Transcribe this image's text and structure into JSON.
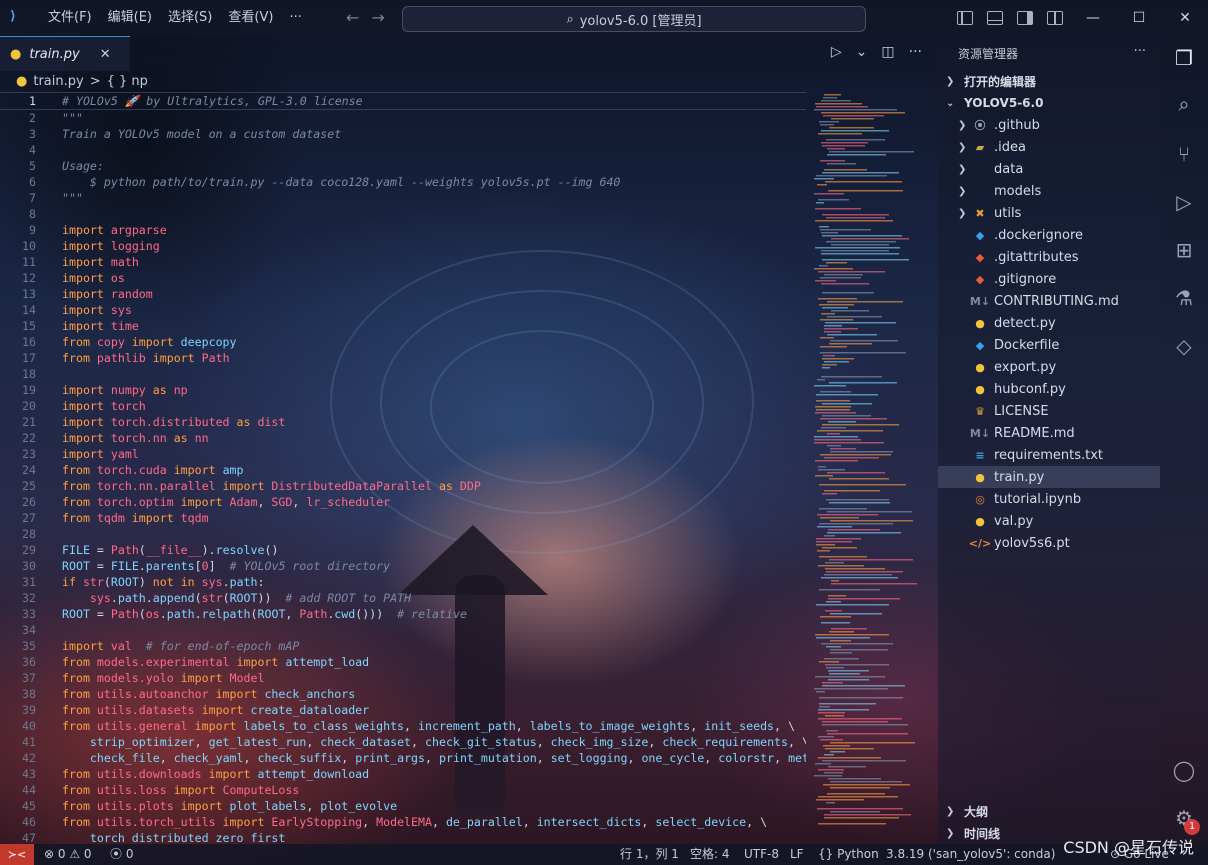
{
  "titlebar": {
    "menus": [
      "文件(F)",
      "编辑(E)",
      "选择(S)",
      "查看(V)"
    ],
    "more": "···",
    "search": "yolov5-6.0 [管理员]"
  },
  "tab": {
    "label": "train.py"
  },
  "breadcrumb": {
    "file": "train.py",
    "sep": ">",
    "symbol": "{ } np"
  },
  "explorer": {
    "header": "资源管理器",
    "more": "···",
    "open_editors": "打开的编辑器",
    "root": "YOLOV5-6.0",
    "items": [
      {
        "name": ".github",
        "type": "folder",
        "icon": "github-folder-icon",
        "glyph": "⦿",
        "color": "#9aa3b6"
      },
      {
        "name": ".idea",
        "type": "folder",
        "icon": "idea-folder-icon",
        "glyph": "▰",
        "color": "#c7a64a"
      },
      {
        "name": "data",
        "type": "folder",
        "icon": "folder-icon",
        "glyph": "",
        "color": "#c4cad8"
      },
      {
        "name": "models",
        "type": "folder",
        "icon": "folder-icon",
        "glyph": "",
        "color": "#c4cad8"
      },
      {
        "name": "utils",
        "type": "folder",
        "icon": "utils-folder-icon",
        "glyph": "✖",
        "color": "#e0a040"
      },
      {
        "name": ".dockerignore",
        "type": "file",
        "icon": "docker-icon",
        "glyph": "◆",
        "color": "#3aa0e6"
      },
      {
        "name": ".gitattributes",
        "type": "file",
        "icon": "git-icon",
        "glyph": "◆",
        "color": "#e55d3b"
      },
      {
        "name": ".gitignore",
        "type": "file",
        "icon": "git-icon",
        "glyph": "◆",
        "color": "#e55d3b"
      },
      {
        "name": "CONTRIBUTING.md",
        "type": "file",
        "icon": "markdown-icon",
        "glyph": "M↓",
        "color": "#7f8aa0"
      },
      {
        "name": "detect.py",
        "type": "file",
        "icon": "python-icon",
        "glyph": "●",
        "color": "#f0c53a"
      },
      {
        "name": "Dockerfile",
        "type": "file",
        "icon": "docker-icon",
        "glyph": "◆",
        "color": "#3aa0e6"
      },
      {
        "name": "export.py",
        "type": "file",
        "icon": "python-icon",
        "glyph": "●",
        "color": "#f0c53a"
      },
      {
        "name": "hubconf.py",
        "type": "file",
        "icon": "python-icon",
        "glyph": "●",
        "color": "#f0c53a"
      },
      {
        "name": "LICENSE",
        "type": "file",
        "icon": "license-icon",
        "glyph": "♛",
        "color": "#e0a040"
      },
      {
        "name": "README.md",
        "type": "file",
        "icon": "markdown-icon",
        "glyph": "M↓",
        "color": "#7f8aa0"
      },
      {
        "name": "requirements.txt",
        "type": "file",
        "icon": "text-file-icon",
        "glyph": "≡",
        "color": "#3aa0e6"
      },
      {
        "name": "train.py",
        "type": "file",
        "icon": "python-icon",
        "glyph": "●",
        "color": "#f0c53a",
        "selected": true
      },
      {
        "name": "tutorial.ipynb",
        "type": "file",
        "icon": "jupyter-icon",
        "glyph": "◎",
        "color": "#e8883a"
      },
      {
        "name": "val.py",
        "type": "file",
        "icon": "python-icon",
        "glyph": "●",
        "color": "#f0c53a"
      },
      {
        "name": "yolov5s6.pt",
        "type": "file",
        "icon": "code-file-icon",
        "glyph": "</>",
        "color": "#e8883a"
      }
    ],
    "outline": "大纲",
    "timeline": "时间线"
  },
  "code": [
    [
      [
        "cm",
        "# YOLOv5 🚀 by Ultralytics, GPL-3.0 license"
      ]
    ],
    [
      [
        "cm",
        "\"\"\""
      ]
    ],
    [
      [
        "cm",
        "Train a YOLOv5 model on a custom dataset"
      ]
    ],
    [],
    [
      [
        "cm",
        "Usage:"
      ]
    ],
    [
      [
        "cm",
        "    $ python path/to/train.py --data coco128.yaml --weights yolov5s.pt --img 640"
      ]
    ],
    [
      [
        "cm",
        "\"\"\""
      ]
    ],
    [],
    [
      [
        "kw",
        "import "
      ],
      [
        "mod",
        "argparse"
      ]
    ],
    [
      [
        "kw",
        "import "
      ],
      [
        "mod",
        "logging"
      ]
    ],
    [
      [
        "kw",
        "import "
      ],
      [
        "mod",
        "math"
      ]
    ],
    [
      [
        "kw",
        "import "
      ],
      [
        "mod",
        "os"
      ]
    ],
    [
      [
        "kw",
        "import "
      ],
      [
        "mod",
        "random"
      ]
    ],
    [
      [
        "kw",
        "import "
      ],
      [
        "mod",
        "sys"
      ]
    ],
    [
      [
        "kw",
        "import "
      ],
      [
        "mod",
        "time"
      ]
    ],
    [
      [
        "kw",
        "from "
      ],
      [
        "mod",
        "copy"
      ],
      [
        "kw",
        " import "
      ],
      [
        "nm",
        "deepcopy"
      ]
    ],
    [
      [
        "kw",
        "from "
      ],
      [
        "mod",
        "pathlib"
      ],
      [
        "kw",
        " import "
      ],
      [
        "mod",
        "Path"
      ]
    ],
    [],
    [
      [
        "kw",
        "import "
      ],
      [
        "mod",
        "numpy"
      ],
      [
        "kw",
        " as "
      ],
      [
        "mod",
        "np"
      ]
    ],
    [
      [
        "kw",
        "import "
      ],
      [
        "mod",
        "torch"
      ]
    ],
    [
      [
        "kw",
        "import "
      ],
      [
        "mod",
        "torch.distributed"
      ],
      [
        "kw",
        " as "
      ],
      [
        "mod",
        "dist"
      ]
    ],
    [
      [
        "kw",
        "import "
      ],
      [
        "mod",
        "torch.nn"
      ],
      [
        "kw",
        " as "
      ],
      [
        "mod",
        "nn"
      ]
    ],
    [
      [
        "kw",
        "import "
      ],
      [
        "mod",
        "yaml"
      ]
    ],
    [
      [
        "kw",
        "from "
      ],
      [
        "mod",
        "torch.cuda"
      ],
      [
        "kw",
        " import "
      ],
      [
        "nm",
        "amp"
      ]
    ],
    [
      [
        "kw",
        "from "
      ],
      [
        "mod",
        "torch.nn.parallel"
      ],
      [
        "kw",
        " import "
      ],
      [
        "mod",
        "DistributedDataParallel"
      ],
      [
        "kw",
        " as "
      ],
      [
        "mod",
        "DDP"
      ]
    ],
    [
      [
        "kw",
        "from "
      ],
      [
        "mod",
        "torch.optim"
      ],
      [
        "kw",
        " import "
      ],
      [
        "mod",
        "Adam"
      ],
      [
        "pl",
        ", "
      ],
      [
        "mod",
        "SGD"
      ],
      [
        "pl",
        ", "
      ],
      [
        "mod",
        "lr_scheduler"
      ]
    ],
    [
      [
        "kw",
        "from "
      ],
      [
        "mod",
        "tqdm"
      ],
      [
        "kw",
        " import "
      ],
      [
        "mod",
        "tqdm"
      ]
    ],
    [],
    [
      [
        "nm",
        "FILE"
      ],
      [
        "pl",
        " = "
      ],
      [
        "mod",
        "Path"
      ],
      [
        "pl",
        "("
      ],
      [
        "mod",
        "__file__"
      ],
      [
        "pl",
        ")."
      ],
      [
        "nm",
        "resolve"
      ],
      [
        "pl",
        "()"
      ]
    ],
    [
      [
        "nm",
        "ROOT"
      ],
      [
        "pl",
        " = "
      ],
      [
        "nm",
        "FILE"
      ],
      [
        "pl",
        "."
      ],
      [
        "nm",
        "parents"
      ],
      [
        "pl",
        "["
      ],
      [
        "mod",
        "0"
      ],
      [
        "pl",
        "]  "
      ],
      [
        "cm",
        "# YOLOv5 root directory"
      ]
    ],
    [
      [
        "kw",
        "if "
      ],
      [
        "mod",
        "str"
      ],
      [
        "pl",
        "("
      ],
      [
        "nm",
        "ROOT"
      ],
      [
        "pl",
        ") "
      ],
      [
        "kw",
        "not in "
      ],
      [
        "mod",
        "sys"
      ],
      [
        "pl",
        "."
      ],
      [
        "nm",
        "path"
      ],
      [
        "pl",
        ":"
      ]
    ],
    [
      [
        "pl",
        "    "
      ],
      [
        "mod",
        "sys"
      ],
      [
        "pl",
        "."
      ],
      [
        "nm",
        "path"
      ],
      [
        "pl",
        "."
      ],
      [
        "nm",
        "append"
      ],
      [
        "pl",
        "("
      ],
      [
        "mod",
        "str"
      ],
      [
        "pl",
        "("
      ],
      [
        "nm",
        "ROOT"
      ],
      [
        "pl",
        "))  "
      ],
      [
        "cm",
        "# add ROOT to PATH"
      ]
    ],
    [
      [
        "nm",
        "ROOT"
      ],
      [
        "pl",
        " = "
      ],
      [
        "mod",
        "Path"
      ],
      [
        "pl",
        "("
      ],
      [
        "mod",
        "os"
      ],
      [
        "pl",
        "."
      ],
      [
        "nm",
        "path"
      ],
      [
        "pl",
        "."
      ],
      [
        "nm",
        "relpath"
      ],
      [
        "pl",
        "("
      ],
      [
        "nm",
        "ROOT"
      ],
      [
        "pl",
        ", "
      ],
      [
        "mod",
        "Path"
      ],
      [
        "pl",
        "."
      ],
      [
        "nm",
        "cwd"
      ],
      [
        "pl",
        "()))  "
      ],
      [
        "cm",
        "# relative"
      ]
    ],
    [],
    [
      [
        "kw",
        "import "
      ],
      [
        "mod",
        "val"
      ],
      [
        "pl",
        "  "
      ],
      [
        "cm",
        "# for end-of-epoch mAP"
      ]
    ],
    [
      [
        "kw",
        "from "
      ],
      [
        "mod",
        "models.experimental"
      ],
      [
        "kw",
        " import "
      ],
      [
        "nm",
        "attempt_load"
      ]
    ],
    [
      [
        "kw",
        "from "
      ],
      [
        "mod",
        "models.yolo"
      ],
      [
        "kw",
        " import "
      ],
      [
        "mod",
        "Model"
      ]
    ],
    [
      [
        "kw",
        "from "
      ],
      [
        "mod",
        "utils.autoanchor"
      ],
      [
        "kw",
        " import "
      ],
      [
        "nm",
        "check_anchors"
      ]
    ],
    [
      [
        "kw",
        "from "
      ],
      [
        "mod",
        "utils.datasets"
      ],
      [
        "kw",
        " import "
      ],
      [
        "nm",
        "create_dataloader"
      ]
    ],
    [
      [
        "kw",
        "from "
      ],
      [
        "mod",
        "utils.general"
      ],
      [
        "kw",
        " import "
      ],
      [
        "nm",
        "labels_to_class_weights"
      ],
      [
        "pl",
        ", "
      ],
      [
        "nm",
        "increment_path"
      ],
      [
        "pl",
        ", "
      ],
      [
        "nm",
        "labels_to_image_weights"
      ],
      [
        "pl",
        ", "
      ],
      [
        "nm",
        "init_seeds"
      ],
      [
        "pl",
        ", \\"
      ]
    ],
    [
      [
        "pl",
        "    "
      ],
      [
        "nm",
        "strip_optimizer"
      ],
      [
        "pl",
        ", "
      ],
      [
        "nm",
        "get_latest_run"
      ],
      [
        "pl",
        ", "
      ],
      [
        "nm",
        "check_dataset"
      ],
      [
        "pl",
        ", "
      ],
      [
        "nm",
        "check_git_status"
      ],
      [
        "pl",
        ", "
      ],
      [
        "nm",
        "check_img_size"
      ],
      [
        "pl",
        ", "
      ],
      [
        "nm",
        "check_requirements"
      ],
      [
        "pl",
        ", \\"
      ]
    ],
    [
      [
        "pl",
        "    "
      ],
      [
        "nm",
        "check_file"
      ],
      [
        "pl",
        ", "
      ],
      [
        "nm",
        "check_yaml"
      ],
      [
        "pl",
        ", "
      ],
      [
        "nm",
        "check_suffix"
      ],
      [
        "pl",
        ", "
      ],
      [
        "nm",
        "print_args"
      ],
      [
        "pl",
        ", "
      ],
      [
        "nm",
        "print_mutation"
      ],
      [
        "pl",
        ", "
      ],
      [
        "nm",
        "set_logging"
      ],
      [
        "pl",
        ", "
      ],
      [
        "nm",
        "one_cycle"
      ],
      [
        "pl",
        ", "
      ],
      [
        "nm",
        "colorstr"
      ],
      [
        "pl",
        ", "
      ],
      [
        "nm",
        "methods"
      ]
    ],
    [
      [
        "kw",
        "from "
      ],
      [
        "mod",
        "utils.downloads"
      ],
      [
        "kw",
        " import "
      ],
      [
        "nm",
        "attempt_download"
      ]
    ],
    [
      [
        "kw",
        "from "
      ],
      [
        "mod",
        "utils.loss"
      ],
      [
        "kw",
        " import "
      ],
      [
        "mod",
        "ComputeLoss"
      ]
    ],
    [
      [
        "kw",
        "from "
      ],
      [
        "mod",
        "utils.plots"
      ],
      [
        "kw",
        " import "
      ],
      [
        "nm",
        "plot_labels"
      ],
      [
        "pl",
        ", "
      ],
      [
        "nm",
        "plot_evolve"
      ]
    ],
    [
      [
        "kw",
        "from "
      ],
      [
        "mod",
        "utils.torch_utils"
      ],
      [
        "kw",
        " import "
      ],
      [
        "mod",
        "EarlyStopping"
      ],
      [
        "pl",
        ", "
      ],
      [
        "mod",
        "ModelEMA"
      ],
      [
        "pl",
        ", "
      ],
      [
        "nm",
        "de_parallel"
      ],
      [
        "pl",
        ", "
      ],
      [
        "nm",
        "intersect_dicts"
      ],
      [
        "pl",
        ", "
      ],
      [
        "nm",
        "select_device"
      ],
      [
        "pl",
        ", \\"
      ]
    ],
    [
      [
        "pl",
        "    "
      ],
      [
        "nm",
        "torch_distributed_zero_first"
      ]
    ]
  ],
  "statusbar": {
    "problems": "⊗ 0 ⚠ 0",
    "ports": "0",
    "position": "行 1，列 1",
    "spaces": "空格: 4",
    "encoding": "UTF-8",
    "eol": "LF",
    "language": "Python",
    "interpreter": "3.8.19 ('san_yolov5': conda)",
    "golive": "Go Live"
  },
  "watermark": "CSDN @星石传说",
  "notifications": "1"
}
